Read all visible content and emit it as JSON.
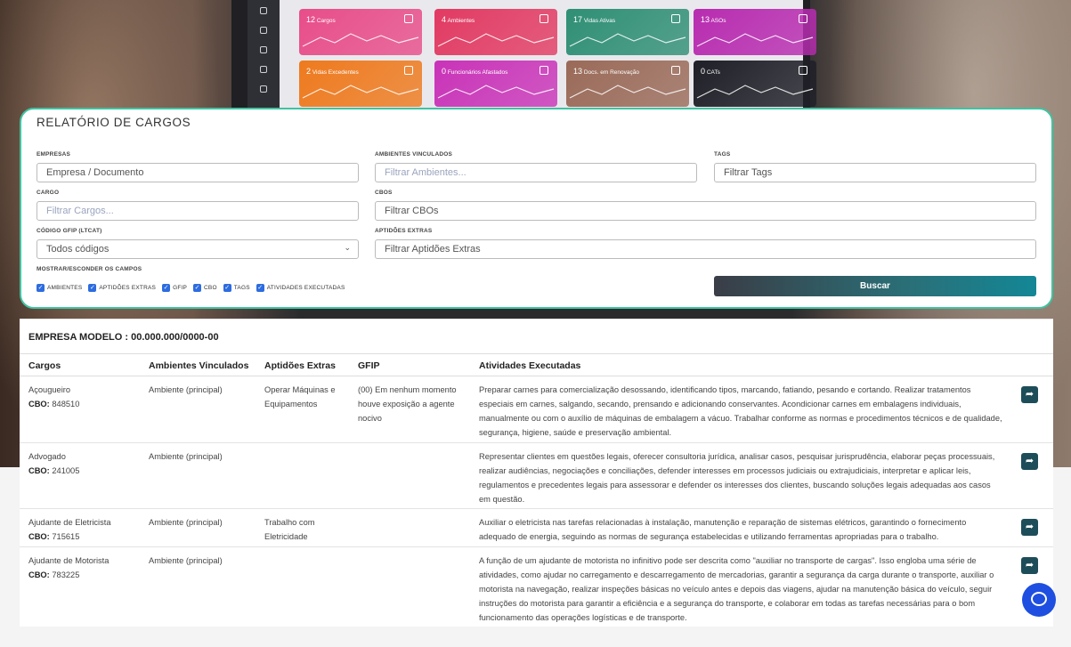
{
  "dashboard": {
    "cards": [
      {
        "count": "12",
        "label": "Cargos",
        "color": "#e84d8a"
      },
      {
        "count": "4",
        "label": "Ambientes",
        "color": "#e23a62"
      },
      {
        "count": "17",
        "label": "Vidas Ativas",
        "color": "#2f8f75"
      },
      {
        "count": "13",
        "label": "ASOs",
        "color": "#b82cb0"
      },
      {
        "count": "2",
        "label": "Vidas Excedentes",
        "color": "#ee7a1e"
      },
      {
        "count": "0",
        "label": "Funcionários Afastados",
        "color": "#c933b8"
      },
      {
        "count": "13",
        "label": "Docs. em Renovação",
        "color": "#9a6a58"
      },
      {
        "count": "0",
        "label": "CATs",
        "color": "#1f1f28"
      }
    ]
  },
  "form": {
    "title": "RELATÓRIO DE CARGOS",
    "empresas_label": "EMPRESAS",
    "empresas_placeholder": "Empresa / Documento",
    "ambientes_label": "AMBIENTES VINCULADOS",
    "ambientes_placeholder": "Filtrar Ambientes...",
    "tags_label": "TAGS",
    "tags_placeholder": "Filtrar Tags",
    "cargo_label": "CARGO",
    "cargo_placeholder": "Filtrar Cargos...",
    "cbos_label": "CBOS",
    "cbos_placeholder": "Filtrar CBOs",
    "gfip_label": "CÓDIGO GFIP (LTCAT)",
    "gfip_value": "Todos códigos",
    "aptidoes_label": "APTIDÕES EXTRAS",
    "aptidoes_placeholder": "Filtrar Aptidões Extras",
    "toggle_label": "MOSTRAR/ESCONDER OS CAMPOS",
    "checkboxes": [
      "AMBIENTES",
      "APTIDÕES EXTRAS",
      "GFIP",
      "CBO",
      "TAGS",
      "ATIVIDADES EXECUTADAS"
    ],
    "search_button": "Buscar"
  },
  "results": {
    "company": "EMPRESA MODELO : 00.000.000/0000-00",
    "columns": [
      "Cargos",
      "Ambientes Vinculados",
      "Aptidões Extras",
      "GFIP",
      "Atividades Executadas"
    ],
    "cbo_prefix": "CBO:",
    "rows": [
      {
        "cargo": "Açougueiro",
        "cbo": "848510",
        "ambiente": "Ambiente (principal)",
        "aptidoes": "Operar Máquinas e Equipamentos",
        "gfip": "(00) Em nenhum momento houve exposição a agente nocivo",
        "atividades": "Preparar carnes para comercialização desossando, identificando tipos, marcando, fatiando, pesando e cortando. Realizar tratamentos especiais em carnes, salgando, secando, prensando e adicionando conservantes. Acondicionar carnes em embalagens individuais, manualmente ou com o auxílio de máquinas de embalagem a vácuo. Trabalhar conforme as normas e procedimentos técnicos e de qualidade, segurança, higiene, saúde e preservação ambiental."
      },
      {
        "cargo": "Advogado",
        "cbo": "241005",
        "ambiente": "Ambiente (principal)",
        "aptidoes": "",
        "gfip": "",
        "atividades": "Representar clientes em questões legais, oferecer consultoria jurídica, analisar casos, pesquisar jurisprudência, elaborar peças processuais, realizar audiências, negociações e conciliações, defender interesses em processos judiciais ou extrajudiciais, interpretar e aplicar leis, regulamentos e precedentes legais para assessorar e defender os interesses dos clientes, buscando soluções legais adequadas aos casos em questão."
      },
      {
        "cargo": "Ajudante de Eletricista",
        "cbo": "715615",
        "ambiente": "Ambiente (principal)",
        "aptidoes": "Trabalho com Eletricidade",
        "gfip": "",
        "atividades": "Auxiliar o eletricista nas tarefas relacionadas à instalação, manutenção e reparação de sistemas elétricos, garantindo o fornecimento adequado de energia, seguindo as normas de segurança estabelecidas e utilizando ferramentas apropriadas para o trabalho."
      },
      {
        "cargo": "Ajudante de Motorista",
        "cbo": "783225",
        "ambiente": "Ambiente (principal)",
        "aptidoes": "",
        "gfip": "",
        "atividades": "A função de um ajudante de motorista no infinitivo pode ser descrita como \"auxiliar no transporte de cargas\". Isso engloba uma série de atividades, como ajudar no carregamento e descarregamento de mercadorias, garantir a segurança da carga durante o transporte, auxiliar o motorista na navegação, realizar inspeções básicas no veículo antes e depois das viagens, ajudar na manutenção básica do veículo, seguir instruções do motorista para garantir a eficiência e a segurança do transporte, e colaborar em todas as tarefas necessárias para o bom funcionamento das operações logísticas e de transporte."
      }
    ]
  }
}
